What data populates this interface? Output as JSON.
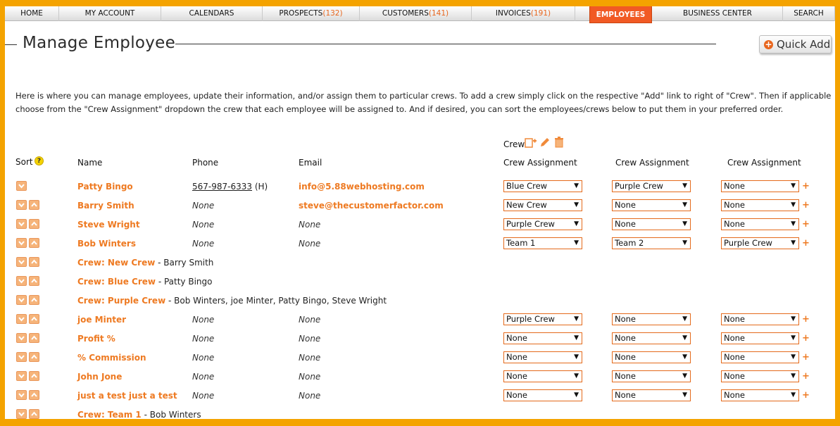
{
  "nav": [
    {
      "label": "HOME",
      "count": ""
    },
    {
      "label": "MY ACCOUNT",
      "count": ""
    },
    {
      "label": "CALENDARS",
      "count": ""
    },
    {
      "label": "PROSPECTS",
      "count": "(132)"
    },
    {
      "label": "CUSTOMERS",
      "count": "(141)"
    },
    {
      "label": "INVOICES",
      "count": "(191)"
    },
    {
      "label": "EMPLOYEES",
      "count": ""
    },
    {
      "label": "BUSINESS CENTER",
      "count": ""
    },
    {
      "label": "SEARCH",
      "count": ""
    }
  ],
  "page": {
    "title": "Manage Employee",
    "quick_add": "Quick Add",
    "intro": "Here is where you can manage employees, update their information, and/or assign them to particular crews. To add a crew simply click on the respective \"Add\" link to right of \"Crew\". Then if applicable choose from the \"Crew Assignment\" dropdown the crew that each employee will be assigned to. And if desired, you can sort the employees/crews below to put them in your preferred order."
  },
  "headers": {
    "sort": "Sort",
    "name": "Name",
    "phone": "Phone",
    "email": "Email",
    "crew": "Crew",
    "crew_assignment_1": "Crew Assignment",
    "crew_assignment_2": "Crew Assignment",
    "crew_assignment_3": "Crew Assignment"
  },
  "rows": [
    {
      "type": "employee",
      "name": "Patty Bingo",
      "phone": "567-987-6333",
      "phone_suffix": "(H)",
      "email": "info@5.88webhosting.com",
      "assign": [
        "Blue Crew",
        "Purple Crew",
        "None"
      ]
    },
    {
      "type": "employee",
      "name": "Barry Smith",
      "phone": "None",
      "phone_suffix": "",
      "email": "steve@thecustomerfactor.com",
      "assign": [
        "New Crew",
        "None",
        "None"
      ]
    },
    {
      "type": "employee",
      "name": "Steve Wright",
      "phone": "None",
      "phone_suffix": "",
      "email": "None",
      "assign": [
        "Purple Crew",
        "None",
        "None"
      ]
    },
    {
      "type": "employee",
      "name": "Bob Winters",
      "phone": "None",
      "phone_suffix": "",
      "email": "None",
      "assign": [
        "Team 1",
        "Team 2",
        "Purple Crew"
      ]
    },
    {
      "type": "crew",
      "name": "Crew: New Crew",
      "members": " - Barry Smith"
    },
    {
      "type": "crew",
      "name": "Crew: Blue Crew",
      "members": " - Patty Bingo"
    },
    {
      "type": "crew",
      "name": "Crew: Purple Crew",
      "members": " - Bob Winters, joe Minter, Patty Bingo, Steve Wright"
    },
    {
      "type": "employee",
      "name": "joe Minter",
      "phone": "None",
      "phone_suffix": "",
      "email": "None",
      "assign": [
        "Purple Crew",
        "None",
        "None"
      ]
    },
    {
      "type": "employee",
      "name": "Profit %",
      "phone": "None",
      "phone_suffix": "",
      "email": "None",
      "assign": [
        "None",
        "None",
        "None"
      ]
    },
    {
      "type": "employee",
      "name": "% Commission",
      "phone": "None",
      "phone_suffix": "",
      "email": "None",
      "assign": [
        "None",
        "None",
        "None"
      ]
    },
    {
      "type": "employee",
      "name": "John Jone",
      "phone": "None",
      "phone_suffix": "",
      "email": "None",
      "assign": [
        "None",
        "None",
        "None"
      ]
    },
    {
      "type": "employee",
      "name": "just a test just a test",
      "phone": "None",
      "phone_suffix": "",
      "email": "None",
      "assign": [
        "None",
        "None",
        "None"
      ]
    },
    {
      "type": "crew",
      "name": "Crew: Team 1",
      "members": " - Bob Winters"
    }
  ],
  "colors": {
    "frame": "#f4a300",
    "accent": "#ee7a22",
    "active_tab": "#f15a24"
  },
  "icons": {
    "add": "+",
    "caret": "▼",
    "help": "?"
  }
}
